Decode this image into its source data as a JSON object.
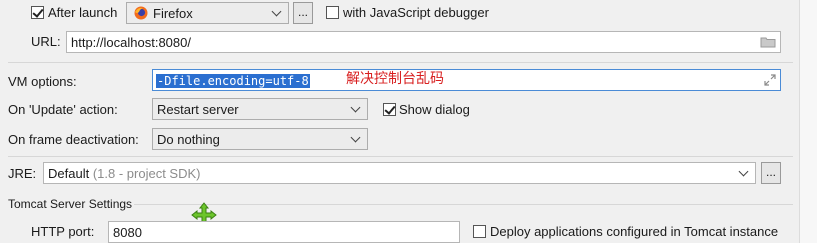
{
  "after_launch": {
    "label": "After launch",
    "checked": true
  },
  "browser": {
    "value": "Firefox",
    "icon": "firefox-icon"
  },
  "browser_more": "...",
  "js_debugger": {
    "label": "with JavaScript debugger",
    "checked": false
  },
  "url": {
    "label": "URL:",
    "value": "http://localhost:8080/"
  },
  "vm": {
    "label": "VM options:",
    "value": "-Dfile.encoding=utf-8",
    "note": "解决控制台乱码"
  },
  "on_update": {
    "label": "On 'Update' action:",
    "value": "Restart server"
  },
  "show_dialog": {
    "label": "Show dialog",
    "checked": true
  },
  "on_frame": {
    "label": "On frame deactivation:",
    "value": "Do nothing"
  },
  "jre": {
    "label": "JRE:",
    "value": "Default",
    "hint": "(1.8 - project SDK)",
    "more": "..."
  },
  "tomcat": {
    "section": "Tomcat Server Settings"
  },
  "http_port": {
    "label": "HTTP port:",
    "value": "8080"
  },
  "deploy": {
    "label": "Deploy applications configured in Tomcat instance",
    "checked": false
  },
  "colors": {
    "selection": "#2b6fd0",
    "note": "#d81f1f",
    "move_cursor": "#6cc52b"
  }
}
